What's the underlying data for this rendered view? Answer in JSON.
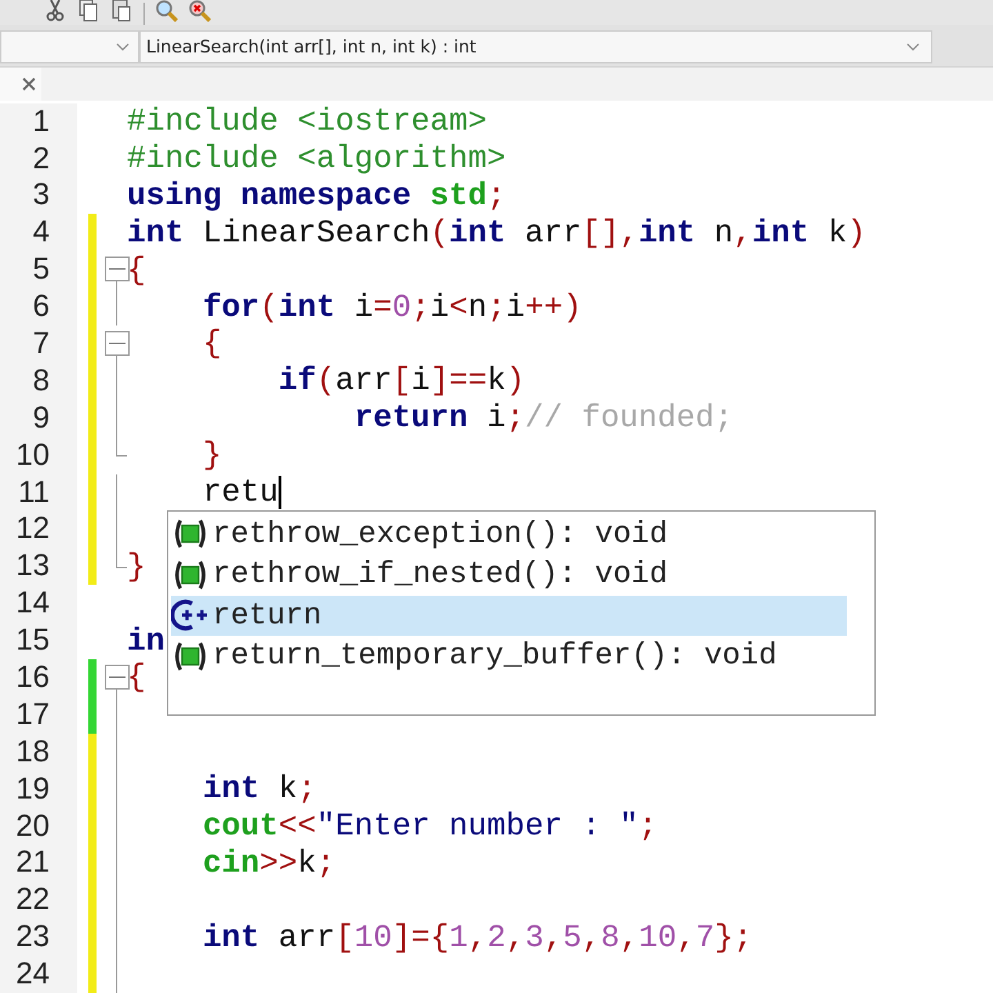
{
  "function_bar": {
    "function": "LinearSearch(int arr[], int n, int k) : int"
  },
  "editor": {
    "lines": [
      {
        "number": "1",
        "tokens": [
          {
            "t": "#include <iostream>",
            "kind": "pp"
          }
        ]
      },
      {
        "number": "2",
        "tokens": [
          {
            "t": "#include <algorithm>",
            "kind": "pp"
          }
        ]
      },
      {
        "number": "3",
        "tokens": [
          {
            "t": "using",
            "kind": "kw"
          },
          {
            "t": " namespace",
            "kind": "kw"
          },
          {
            "t": " std",
            "kind": "lib"
          },
          {
            "t": ";",
            "kind": "op"
          }
        ]
      },
      {
        "number": "4",
        "color": "#f2ec17",
        "tokens": [
          {
            "t": "int",
            "kind": "kw"
          },
          {
            "t": " LinearSearch",
            "kind": "id"
          },
          {
            "t": "(",
            "kind": "op"
          },
          {
            "t": "int",
            "kind": "kw"
          },
          {
            "t": " arr",
            "kind": "id"
          },
          {
            "t": "[],",
            "kind": "op"
          },
          {
            "t": "int",
            "kind": "kw"
          },
          {
            "t": " n",
            "kind": "id"
          },
          {
            "t": ",",
            "kind": "op"
          },
          {
            "t": "int",
            "kind": "kw"
          },
          {
            "t": " k",
            "kind": "id"
          },
          {
            "t": ")",
            "kind": "op"
          }
        ]
      },
      {
        "number": "5",
        "color": "#f2ec17",
        "fold_start": true,
        "tokens": [
          {
            "t": "{",
            "kind": "op"
          }
        ]
      },
      {
        "number": "6",
        "color": "#f2ec17",
        "tokens": [
          {
            "t": "    for",
            "kind": "kw"
          },
          {
            "t": "(",
            "kind": "op"
          },
          {
            "t": "int",
            "kind": "kw"
          },
          {
            "t": " i",
            "kind": "id"
          },
          {
            "t": "=",
            "kind": "op"
          },
          {
            "t": "0",
            "kind": "num"
          },
          {
            "t": ";",
            "kind": "op"
          },
          {
            "t": "i",
            "kind": "id"
          },
          {
            "t": "<",
            "kind": "op"
          },
          {
            "t": "n",
            "kind": "id"
          },
          {
            "t": ";",
            "kind": "op"
          },
          {
            "t": "i",
            "kind": "id"
          },
          {
            "t": "++)",
            "kind": "op"
          }
        ]
      },
      {
        "number": "7",
        "color": "#f2ec17",
        "fold_start": true,
        "tokens": [
          {
            "t": "    {",
            "kind": "op"
          }
        ]
      },
      {
        "number": "8",
        "color": "#f2ec17",
        "tokens": [
          {
            "t": "        if",
            "kind": "kw"
          },
          {
            "t": "(",
            "kind": "op"
          },
          {
            "t": "arr",
            "kind": "id"
          },
          {
            "t": "[",
            "kind": "op"
          },
          {
            "t": "i",
            "kind": "id"
          },
          {
            "t": "]==",
            "kind": "op"
          },
          {
            "t": "k",
            "kind": "id"
          },
          {
            "t": ")",
            "kind": "op"
          }
        ]
      },
      {
        "number": "9",
        "color": "#f2ec17",
        "tokens": [
          {
            "t": "            return",
            "kind": "kw"
          },
          {
            "t": " i",
            "kind": "id"
          },
          {
            "t": ";",
            "kind": "op"
          },
          {
            "t": "// founded;",
            "kind": "cm"
          }
        ]
      },
      {
        "number": "10",
        "color": "#f2ec17",
        "fold_end": true,
        "tokens": [
          {
            "t": "    }",
            "kind": "op"
          }
        ]
      },
      {
        "number": "11",
        "color": "#f2ec17",
        "caret": true,
        "tokens": [
          {
            "t": "    retu",
            "kind": "id"
          }
        ]
      },
      {
        "number": "12",
        "color": "#f2ec17"
      },
      {
        "number": "13",
        "color": "#f2ec17",
        "fold_end": true,
        "tokens": [
          {
            "t": "}",
            "kind": "op"
          }
        ]
      },
      {
        "number": "14"
      },
      {
        "number": "15",
        "tokens": [
          {
            "t": "in",
            "kind": "kw"
          }
        ]
      },
      {
        "number": "16",
        "color": "#34d634",
        "fold_start": true,
        "tokens": [
          {
            "t": "{",
            "kind": "op"
          }
        ]
      },
      {
        "number": "17",
        "color": "#34d634"
      },
      {
        "number": "18",
        "color": "#f2ec17"
      },
      {
        "number": "19",
        "color": "#f2ec17",
        "tokens": [
          {
            "t": "    int",
            "kind": "kw"
          },
          {
            "t": " k",
            "kind": "id"
          },
          {
            "t": ";",
            "kind": "op"
          }
        ]
      },
      {
        "number": "20",
        "color": "#f2ec17",
        "tokens": [
          {
            "t": "    cout",
            "kind": "lib"
          },
          {
            "t": "<<",
            "kind": "op"
          },
          {
            "t": "\"Enter number : \"",
            "kind": "str"
          },
          {
            "t": ";",
            "kind": "op"
          }
        ]
      },
      {
        "number": "21",
        "color": "#f2ec17",
        "tokens": [
          {
            "t": "    cin",
            "kind": "lib"
          },
          {
            "t": ">>",
            "kind": "op"
          },
          {
            "t": "k",
            "kind": "id"
          },
          {
            "t": ";",
            "kind": "op"
          }
        ]
      },
      {
        "number": "22",
        "color": "#f2ec17"
      },
      {
        "number": "23",
        "color": "#f2ec17",
        "tokens": [
          {
            "t": "    int",
            "kind": "kw"
          },
          {
            "t": " arr",
            "kind": "id"
          },
          {
            "t": "[",
            "kind": "op"
          },
          {
            "t": "10",
            "kind": "num"
          },
          {
            "t": "]={",
            "kind": "op"
          },
          {
            "t": "1",
            "kind": "num"
          },
          {
            "t": ",",
            "kind": "op"
          },
          {
            "t": "2",
            "kind": "num"
          },
          {
            "t": ",",
            "kind": "op"
          },
          {
            "t": "3",
            "kind": "num"
          },
          {
            "t": ",",
            "kind": "op"
          },
          {
            "t": "5",
            "kind": "num"
          },
          {
            "t": ",",
            "kind": "op"
          },
          {
            "t": "8",
            "kind": "num"
          },
          {
            "t": ",",
            "kind": "op"
          },
          {
            "t": "10",
            "kind": "num"
          },
          {
            "t": ",",
            "kind": "op"
          },
          {
            "t": "7",
            "kind": "num"
          },
          {
            "t": "};",
            "kind": "op"
          }
        ]
      },
      {
        "number": "24",
        "color": "#f2ec17"
      }
    ]
  },
  "completion": {
    "items": [
      {
        "kind": "function",
        "label": "rethrow_exception(): void",
        "selected": false
      },
      {
        "kind": "function",
        "label": "rethrow_if_nested(): void",
        "selected": false
      },
      {
        "kind": "keyword",
        "label": "return",
        "selected": true
      },
      {
        "kind": "function",
        "label": "return_temporary_buffer(): void",
        "selected": false
      }
    ]
  }
}
